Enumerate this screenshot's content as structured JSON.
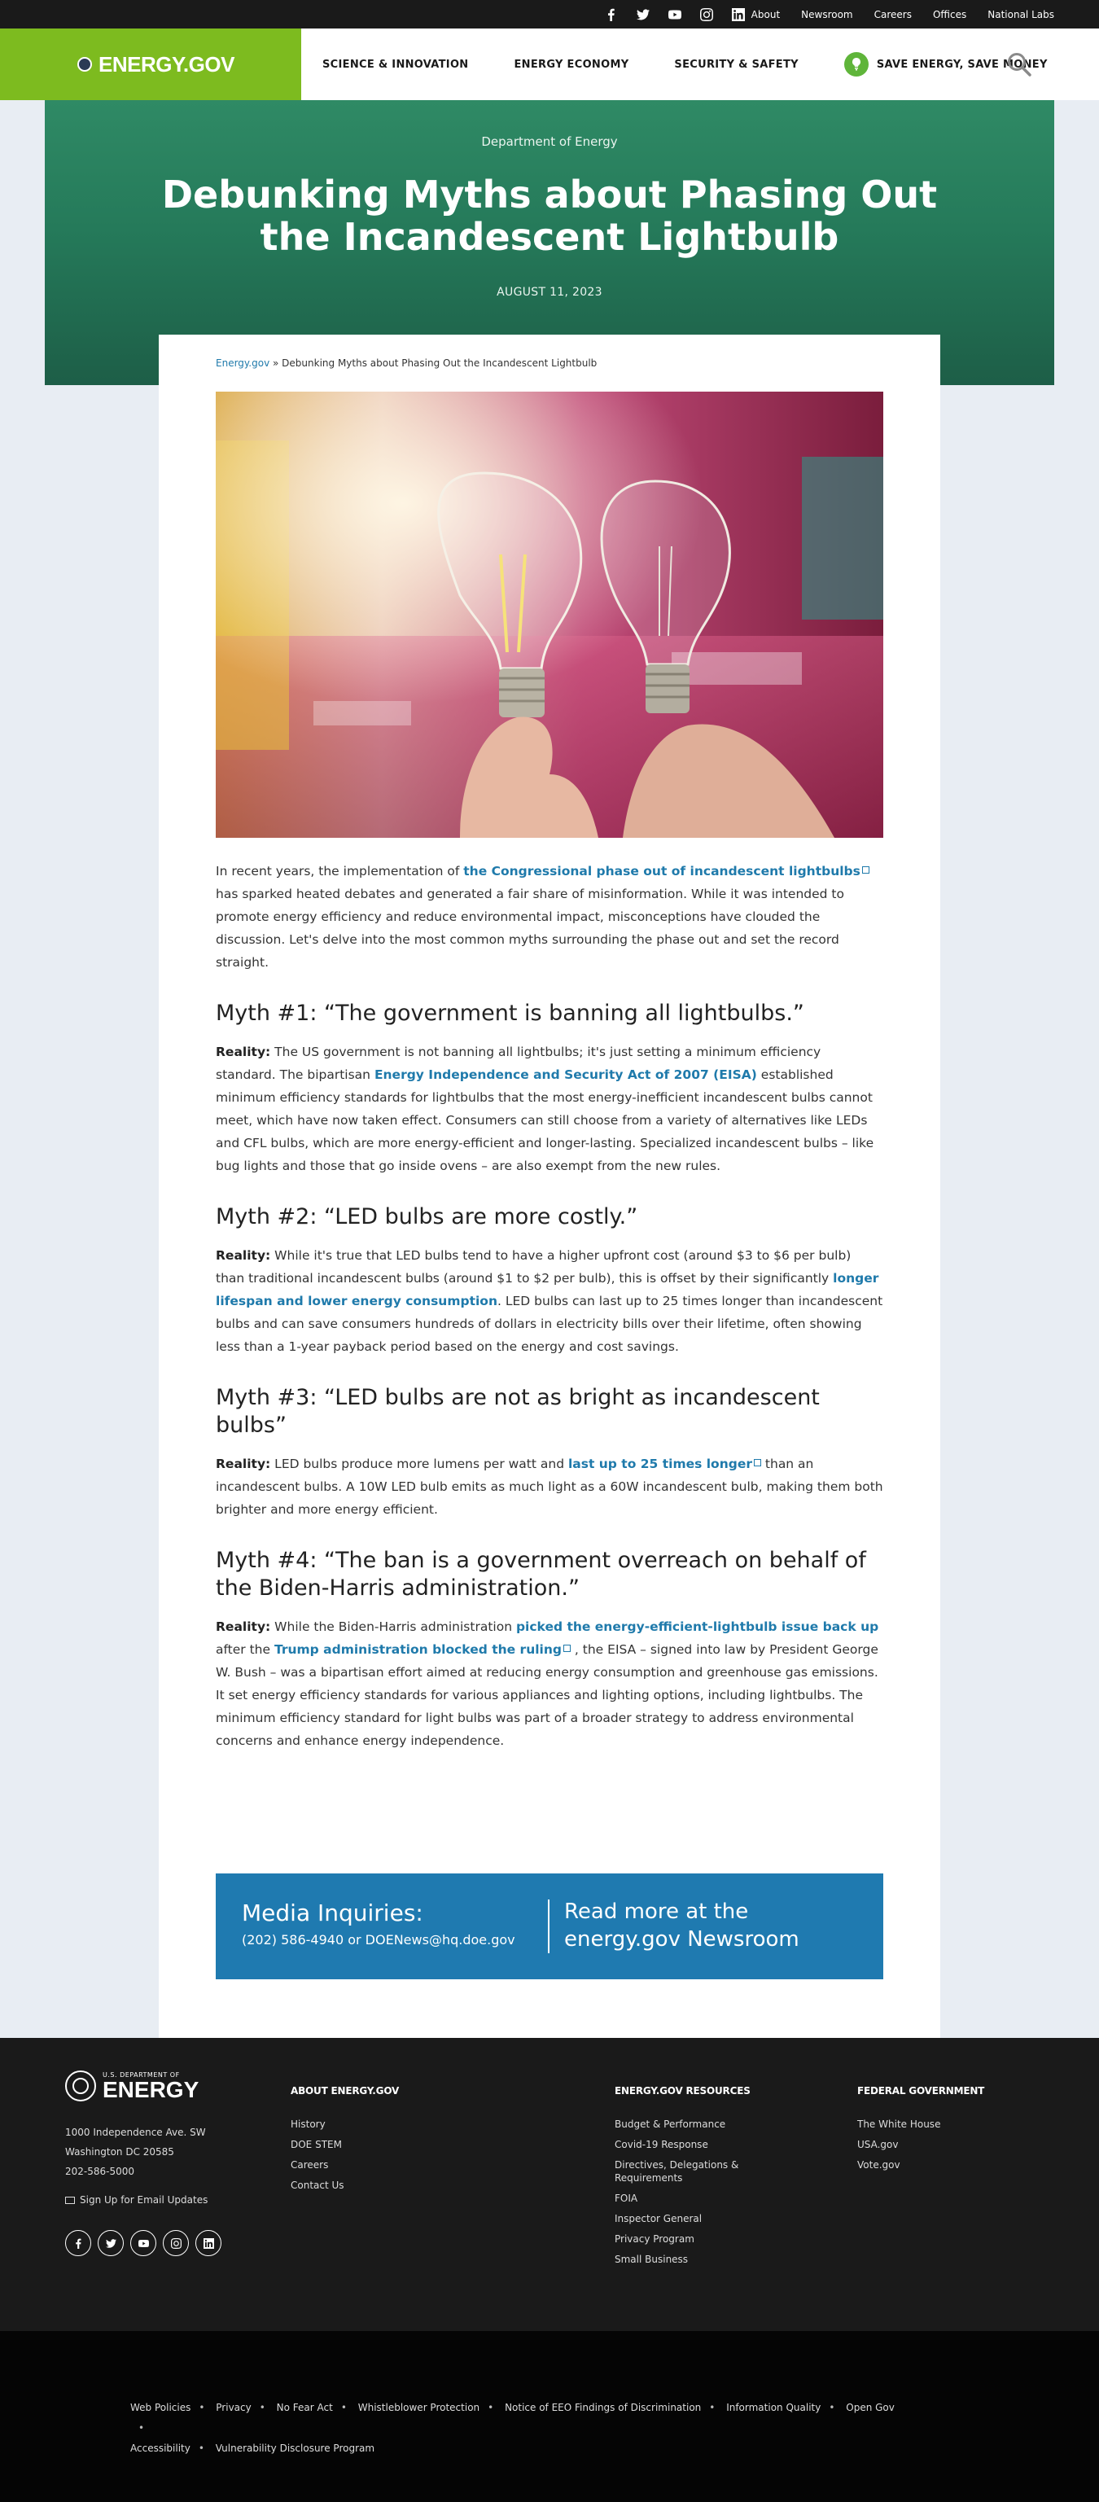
{
  "utility": {
    "social_icons": [
      "facebook-icon",
      "twitter-icon",
      "youtube-icon",
      "instagram-icon",
      "linkedin-icon"
    ],
    "links": [
      "About",
      "Newsroom",
      "Careers",
      "Offices",
      "National Labs"
    ]
  },
  "header": {
    "logo_text": "ENERGY.GOV",
    "nav": [
      "SCIENCE & INNOVATION",
      "ENERGY ECONOMY",
      "SECURITY & SAFETY"
    ],
    "save_energy": "SAVE ENERGY, SAVE MONEY",
    "colors": {
      "logo_bg": "#7dbb1f",
      "save_icon_bg": "#5fb53a"
    }
  },
  "hero": {
    "kicker": "Department of Energy",
    "title": "Debunking Myths about Phasing Out the Incandescent Lightbulb",
    "date": "AUGUST 11, 2023",
    "color": "#2f8a65"
  },
  "breadcrumb": {
    "home": "Energy.gov",
    "separator": " » ",
    "current": "Debunking Myths about Phasing Out the Incandescent Lightbulb"
  },
  "article": {
    "intro": {
      "before": "In recent years, the implementation of ",
      "link": "the Congressional phase out of incandescent lightbulbs",
      "after": " has sparked heated debates and generated a fair share of misinformation. While it was intended to promote energy efficiency and reduce environmental impact, misconceptions have clouded the discussion. Let's delve into the most common myths surrounding the phase out and set the record straight."
    },
    "myth1": {
      "heading": "Myth #1: “The government is banning all lightbulbs.”",
      "label": "Reality:",
      "before": " The US government is not banning all lightbulbs; it's just setting a minimum efficiency standard. The bipartisan ",
      "link": "Energy Independence and Security Act of 2007 (EISA)",
      "after": " established minimum efficiency standards for lightbulbs that the most energy-inefficient incandescent bulbs cannot meet, which have now taken effect. Consumers can still choose from a variety of alternatives like LEDs and CFL bulbs, which are more energy-efficient and longer-lasting. Specialized incandescent bulbs – like bug lights and those that go inside ovens – are also exempt from the new rules."
    },
    "myth2": {
      "heading": "Myth #2: “LED bulbs are more costly.”",
      "label": "Reality:",
      "before": " While it's true that LED bulbs tend to have a higher upfront cost (around $3 to $6 per bulb) than traditional incandescent bulbs (around $1 to $2 per bulb), this is offset by their significantly ",
      "link": "longer lifespan and lower energy consumption",
      "after": ". LED bulbs can last up to 25 times longer than incandescent bulbs and can save consumers hundreds of dollars in electricity bills over their lifetime, often showing less than a 1-year payback period based on the energy and cost savings."
    },
    "myth3": {
      "heading": "Myth #3: “LED bulbs are not as bright as incandescent bulbs”",
      "label": "Reality:",
      "before": " LED bulbs produce more lumens per watt and ",
      "link": "last up to 25 times longer",
      "after": "  than an incandescent bulbs. A 10W LED bulb emits as much light as a 60W incandescent bulb, making them both brighter and more energy efficient."
    },
    "myth4": {
      "heading": "Myth #4: “The ban is a government overreach on behalf of the Biden-Harris administration.”",
      "label": "Reality:",
      "before": " While the Biden-Harris administration ",
      "link1": "picked the energy-efficient-lightbulb issue back up",
      "middle": " after the ",
      "link2": "Trump administration blocked the ruling",
      "after": " , the EISA – signed into law by President George W. Bush – was a bipartisan effort aimed at reducing energy consumption and greenhouse gas emissions. It set energy efficiency standards for various appliances and lighting options, including lightbulbs. The minimum efficiency standard for light bulbs was part of a broader strategy to address environmental concerns and enhance energy independence."
    }
  },
  "media": {
    "title": "Media Inquiries:",
    "contact": "(202) 586-4940 or DOENews@hq.doe.gov",
    "read_more": "Read more at the energy.gov Newsroom",
    "color": "#1f7ab0"
  },
  "footer": {
    "logo_small": "U.S. DEPARTMENT OF",
    "logo_big": "ENERGY",
    "address": [
      "1000 Independence Ave. SW",
      "Washington DC 20585",
      "202-586-5000"
    ],
    "signup": "Sign Up for Email Updates",
    "social_icons": [
      "facebook-icon",
      "twitter-icon",
      "youtube-icon",
      "instagram-icon",
      "linkedin-icon"
    ],
    "columns": [
      {
        "title": "ABOUT ENERGY.GOV",
        "links": [
          "History",
          "DOE STEM",
          "Careers",
          "Contact Us"
        ]
      },
      {
        "title": "ENERGY.GOV RESOURCES",
        "links": [
          "Budget & Performance",
          "Covid-19 Response",
          "Directives, Delegations & Requirements",
          "FOIA",
          "Inspector General",
          "Privacy Program",
          "Small Business"
        ]
      },
      {
        "title": "FEDERAL GOVERNMENT",
        "links": [
          "The White House",
          "USA.gov",
          "Vote.gov"
        ]
      }
    ]
  },
  "subfooter": {
    "links": [
      "Web Policies",
      "Privacy",
      "No Fear Act",
      "Whistleblower Protection",
      "Notice of EEO Findings of Discrimination",
      "Information Quality",
      "Open Gov",
      "Accessibility",
      "Vulnerability Disclosure Program"
    ]
  }
}
